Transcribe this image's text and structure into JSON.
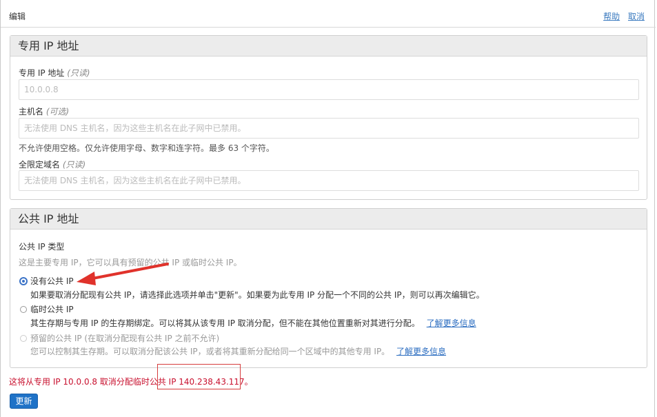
{
  "header": {
    "title": "编辑",
    "help_link": "帮助",
    "cancel_link": "取消"
  },
  "private_ip_panel": {
    "title": "专用 IP 地址",
    "private_ip_label": "专用 IP 地址",
    "private_ip_qualifier": "(只读)",
    "private_ip_value": "10.0.0.8",
    "hostname_label": "主机名",
    "hostname_qualifier": "(可选)",
    "hostname_placeholder": "无法使用 DNS 主机名，因为这些主机名在此子网中已禁用。",
    "hostname_hint": "不允许使用空格。仅允许使用字母、数字和连字符。最多 63 个字符。",
    "fqdn_label": "全限定域名",
    "fqdn_qualifier": "(只读)",
    "fqdn_placeholder": "无法使用 DNS 主机名，因为这些主机名在此子网中已禁用。"
  },
  "public_ip_panel": {
    "title": "公共 IP 地址",
    "type_label": "公共 IP 类型",
    "type_hint": "这是主要专用 IP，它可以具有预留的公共 IP 或临时公共 IP。",
    "options": [
      {
        "label": "没有公共 IP",
        "description": "如果要取消分配现有公共 IP，请选择此选项并单击\"更新\"。如果要为此专用 IP 分配一个不同的公共 IP，则可以再次编辑它。",
        "selected": true,
        "disabled": false
      },
      {
        "label": "临时公共 IP",
        "description": "其生存期与专用 IP 的生存期绑定。可以将其从该专用 IP 取消分配，但不能在其他位置重新对其进行分配。",
        "link": "了解更多信息",
        "selected": false,
        "disabled": false
      },
      {
        "label": "预留的公共 IP (在取消分配现有公共 IP 之前不允许)",
        "description": "您可以控制其生存期。可以取消分配该公共 IP，或者将其重新分配给同一个区域中的其他专用 IP。",
        "link": "了解更多信息",
        "selected": false,
        "disabled": true
      }
    ]
  },
  "warning_text": "这将从专用 IP 10.0.0.8 取消分配临时公共 IP 140.238.43.117。",
  "update_button": "更新",
  "colors": {
    "accent": "#1f72c7",
    "warning": "#c8102e",
    "annotation": "#e0322b"
  }
}
